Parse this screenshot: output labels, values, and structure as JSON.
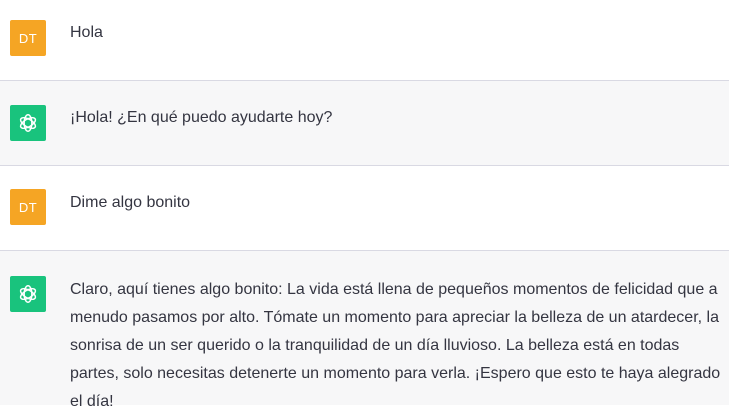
{
  "messages": [
    {
      "role": "user",
      "avatar_initials": "DT",
      "text": "Hola"
    },
    {
      "role": "assistant",
      "avatar_icon": "openai-logo-icon",
      "text": "¡Hola! ¿En qué puedo ayudarte hoy?"
    },
    {
      "role": "user",
      "avatar_initials": "DT",
      "text": "Dime algo bonito"
    },
    {
      "role": "assistant",
      "avatar_icon": "openai-logo-icon",
      "text": "Claro, aquí tienes algo bonito: La vida está llena de pequeños momentos de felicidad que a menudo pasamos por alto. Tómate un momento para apreciar la belleza de un atardecer, la sonrisa de un ser querido o la tranquilidad de un día lluvioso. La belleza está en todas partes, solo necesitas detenerte un momento para verla. ¡Espero que esto te haya alegrado el día!"
    }
  ],
  "colors": {
    "user_avatar_bg": "#f5a524",
    "assistant_avatar_bg": "#19c37d",
    "assistant_row_bg": "#f7f7f8",
    "divider": "#d9d9e3",
    "text": "#343541"
  }
}
